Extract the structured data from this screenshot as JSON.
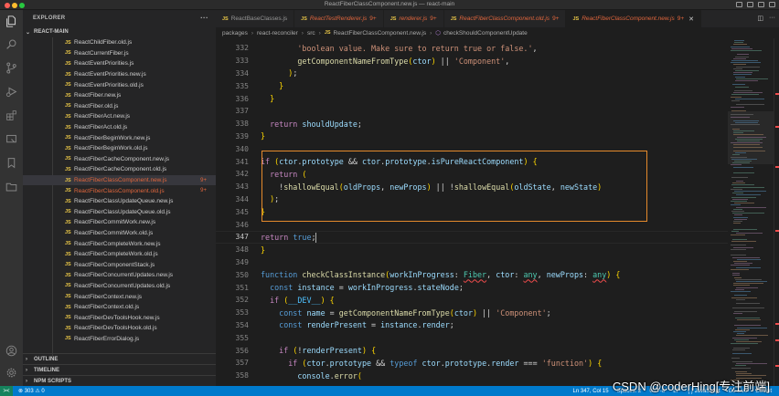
{
  "window": {
    "title": "ReactFiberClassComponent.new.js — react-main"
  },
  "explorer": {
    "header": "EXPLORER",
    "more_icon": "ellipsis-icon",
    "root": "REACT-MAIN",
    "files": [
      "ReactChildFiber.old.js",
      "ReactCurrentFiber.js",
      "ReactEventPriorities.js",
      "ReactEventPriorities.new.js",
      "ReactEventPriorities.old.js",
      "ReactFiber.new.js",
      "ReactFiber.old.js",
      "ReactFiberAct.new.js",
      "ReactFiberAct.old.js",
      "ReactFiberBeginWork.new.js",
      "ReactFiberBeginWork.old.js",
      "ReactFiberCacheComponent.new.js",
      "ReactFiberCacheComponent.old.js",
      "ReactFiberClassComponent.new.js",
      "ReactFiberClassComponent.old.js",
      "ReactFiberClassUpdateQueue.new.js",
      "ReactFiberClassUpdateQueue.old.js",
      "ReactFiberCommitWork.new.js",
      "ReactFiberCommitWork.old.js",
      "ReactFiberCompleteWork.new.js",
      "ReactFiberCompleteWork.old.js",
      "ReactFiberComponentStack.js",
      "ReactFiberConcurrentUpdates.new.js",
      "ReactFiberConcurrentUpdates.old.js",
      "ReactFiberContext.new.js",
      "ReactFiberContext.old.js",
      "ReactFiberDevToolsHook.new.js",
      "ReactFiberDevToolsHook.old.js",
      "ReactFiberErrorDialog.js"
    ],
    "file_icon_label": "JS",
    "active_file": {
      "name": "ReactFiberClassComponent.new.js",
      "badge": "9+"
    },
    "modified_file": {
      "name": "ReactFiberClassComponent.old.js",
      "badge": "9+"
    },
    "sections": [
      "OUTLINE",
      "TIMELINE",
      "NPM SCRIPTS"
    ]
  },
  "tabs": [
    {
      "label": "ReactBaseClasses.js",
      "count": ""
    },
    {
      "label": "ReactTestRenderer.js",
      "count": "9+"
    },
    {
      "label": "renderer.js",
      "count": "9+"
    },
    {
      "label": "ReactFiberClassComponent.old.js",
      "count": "9+"
    },
    {
      "label": "ReactFiberClassComponent.new.js",
      "count": "9+"
    }
  ],
  "breadcrumb": [
    "packages",
    "react-reconciler",
    "src",
    "ReactFiberClassComponent.new.js",
    "checkShouldComponentUpdate"
  ],
  "editor": {
    "current_line": "347",
    "lines": [
      {
        "n": "332",
        "text": "        'boolean value. Make sure to return true or false.',"
      },
      {
        "n": "333",
        "text": "        getComponentNameFromType(ctor) || 'Component',"
      },
      {
        "n": "334",
        "text": "      );"
      },
      {
        "n": "335",
        "text": "    }"
      },
      {
        "n": "336",
        "text": "  }"
      },
      {
        "n": "337",
        "text": ""
      },
      {
        "n": "338",
        "text": "  return shouldUpdate;"
      },
      {
        "n": "339",
        "text": "}"
      },
      {
        "n": "340",
        "text": ""
      },
      {
        "n": "341",
        "text": "if (ctor.prototype && ctor.prototype.isPureReactComponent) {"
      },
      {
        "n": "342",
        "text": "  return ("
      },
      {
        "n": "343",
        "text": "    !shallowEqual(oldProps, newProps) || !shallowEqual(oldState, newState)"
      },
      {
        "n": "344",
        "text": "  );"
      },
      {
        "n": "345",
        "text": "}"
      },
      {
        "n": "346",
        "text": ""
      },
      {
        "n": "347",
        "text": "return true;"
      },
      {
        "n": "348",
        "text": "}"
      },
      {
        "n": "349",
        "text": ""
      },
      {
        "n": "350",
        "text": "function checkClassInstance(workInProgress: Fiber, ctor: any, newProps: any) {"
      },
      {
        "n": "351",
        "text": "  const instance = workInProgress.stateNode;"
      },
      {
        "n": "352",
        "text": "  if (__DEV__) {"
      },
      {
        "n": "353",
        "text": "    const name = getComponentNameFromType(ctor) || 'Component';"
      },
      {
        "n": "354",
        "text": "    const renderPresent = instance.render;"
      },
      {
        "n": "355",
        "text": ""
      },
      {
        "n": "356",
        "text": "    if (!renderPresent) {"
      },
      {
        "n": "357",
        "text": "      if (ctor.prototype && typeof ctor.prototype.render === 'function') {"
      },
      {
        "n": "358",
        "text": "        console.error("
      }
    ]
  },
  "statusbar": {
    "remote_icon": "remote-icon",
    "problems": "⊗ 303 ⚠ 0",
    "position": "Ln 347, Col 15",
    "spaces": "Spaces: 2",
    "encoding": "UTF-8",
    "eol": "LF",
    "language": "{ } JavaScript",
    "live": "Go Live",
    "eslint": "ESLint"
  },
  "watermark": "CSDN @coderHing[专注前端]",
  "colors": {
    "accent": "#007acc",
    "highlight_box": "#e58a2c",
    "modified": "#e0663d",
    "sidebar_bg": "#252526",
    "editor_bg": "#1e1e1e"
  }
}
